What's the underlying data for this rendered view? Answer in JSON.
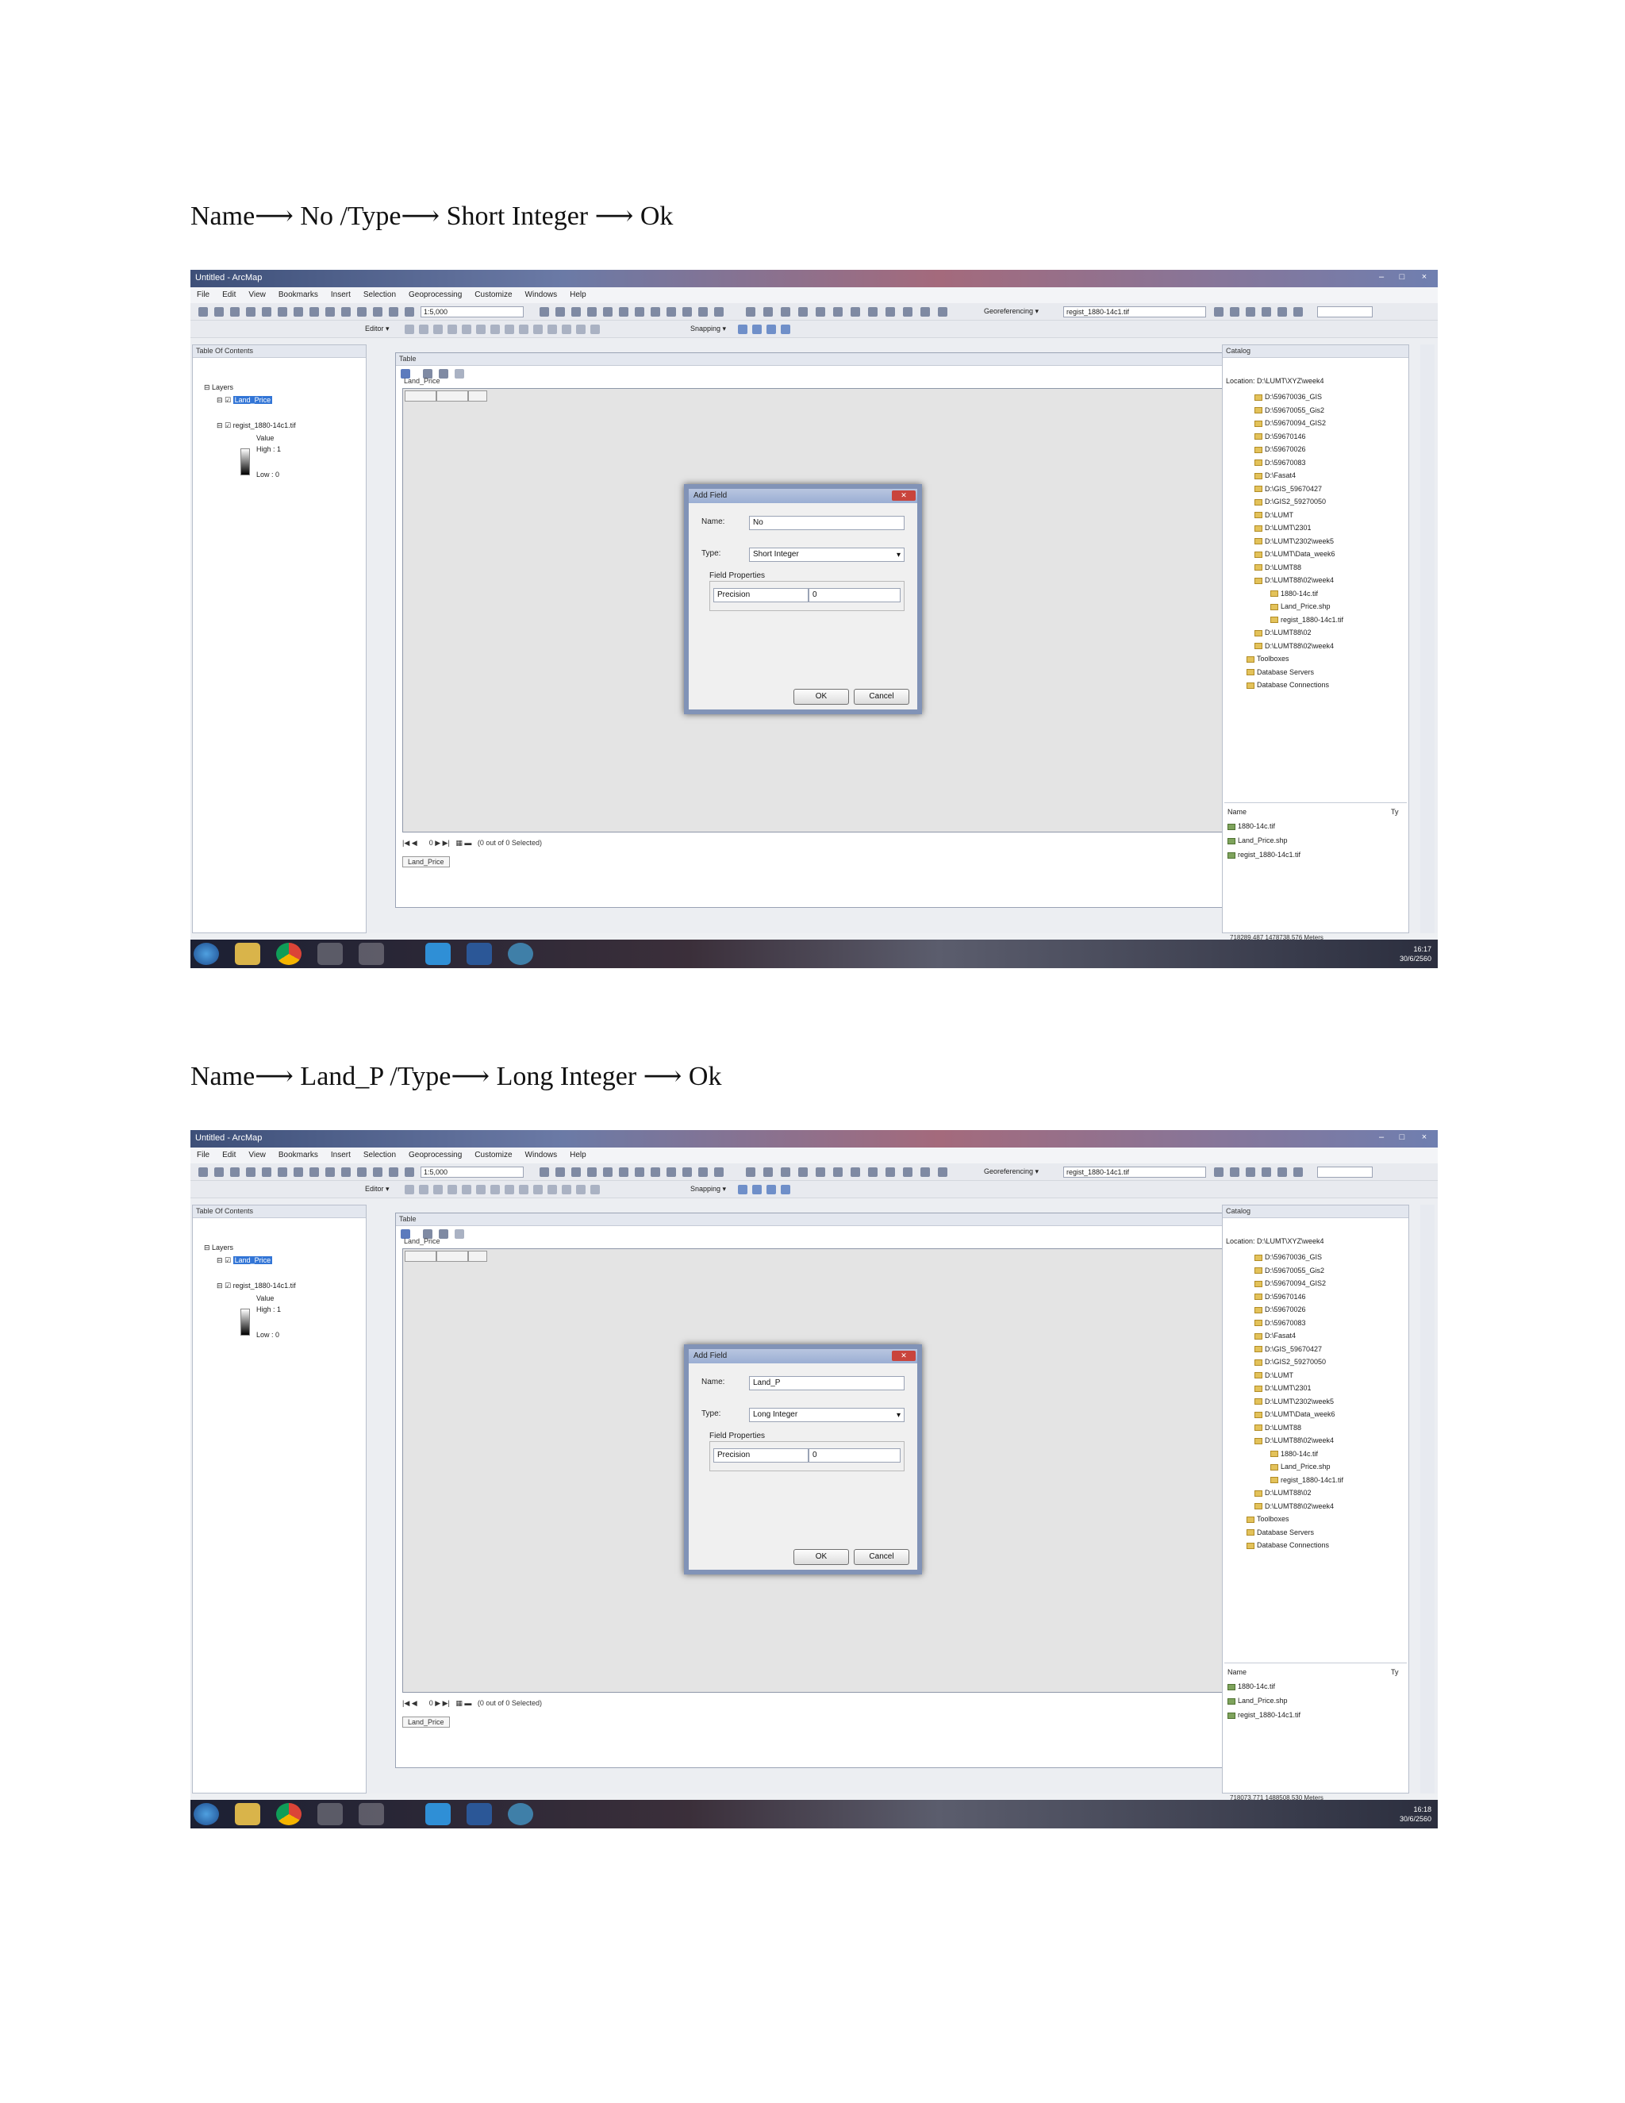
{
  "steps": [
    {
      "caption": "Name⟶ No /Type⟶ Short Integer ⟶ Ok",
      "screenshot": {
        "window_title": "Untitled - ArcMap",
        "menus": [
          "File",
          "Edit",
          "View",
          "Bookmarks",
          "Insert",
          "Selection",
          "Geoprocessing",
          "Customize",
          "Windows",
          "Help"
        ],
        "scale": "1:5,000",
        "georef_label": "Georeferencing ▾",
        "georef_layer": "regist_1880-14c1.tif",
        "editor_label": "Editor ▾",
        "snapping_label": "Snapping ▾",
        "toc": {
          "title": "Table Of Contents",
          "layers_label": "Layers",
          "layer1": "Land_Price",
          "layer2": "regist_1880-14c1.tif",
          "value_label": "Value",
          "high": "High : 1",
          "low": "Low : 0"
        },
        "table": {
          "title": "Table",
          "tab": "Land_Price",
          "nav": "0",
          "selected": "(0 out of 0 Selected)",
          "bottom_tab": "Land_Price"
        },
        "dialog": {
          "title": "Add Field",
          "name_label": "Name:",
          "name_value": "No",
          "type_label": "Type:",
          "type_value": "Short Integer",
          "props_label": "Field Properties",
          "precision_label": "Precision",
          "precision_value": "0",
          "ok": "OK",
          "cancel": "Cancel"
        },
        "catalog": {
          "title": "Catalog",
          "location_label": "Location:",
          "location": "D:\\LUMT\\XYZ\\week4",
          "items": [
            "D:\\59670036_GIS",
            "D:\\59670055_Gis2",
            "D:\\59670094_GIS2",
            "D:\\59670146",
            "D:\\59670026",
            "D:\\59670083",
            "D:\\Fasat4",
            "D:\\GIS_59670427",
            "D:\\GIS2_59270050",
            "D:\\LUMT",
            "D:\\LUMT\\2301",
            "D:\\LUMT\\2302\\week5",
            "D:\\LUMT\\Data_week6",
            "D:\\LUMT88",
            "D:\\LUMT88\\02\\week4",
            "1880-14c.tif",
            "Land_Price.shp",
            "regist_1880-14c1.tif",
            "D:\\LUMT88\\02",
            "D:\\LUMT88\\02\\week4",
            "Toolboxes",
            "Database Servers",
            "Database Connections"
          ],
          "list_header_name": "Name",
          "list_header_type": "Ty",
          "list_items": [
            "1880-14c.tif",
            "Land_Price.shp",
            "regist_1880-14c1.tif"
          ]
        },
        "status_coords": "718289.487 1478738.576 Meters",
        "clock_time": "16:17",
        "clock_date": "30/6/2560"
      }
    },
    {
      "caption": "Name⟶ Land_P /Type⟶ Long Integer ⟶ Ok",
      "screenshot": {
        "window_title": "Untitled - ArcMap",
        "menus": [
          "File",
          "Edit",
          "View",
          "Bookmarks",
          "Insert",
          "Selection",
          "Geoprocessing",
          "Customize",
          "Windows",
          "Help"
        ],
        "scale": "1:5,000",
        "georef_label": "Georeferencing ▾",
        "georef_layer": "regist_1880-14c1.tif",
        "editor_label": "Editor ▾",
        "snapping_label": "Snapping ▾",
        "toc": {
          "title": "Table Of Contents",
          "layers_label": "Layers",
          "layer1": "Land_Price",
          "layer2": "regist_1880-14c1.tif",
          "value_label": "Value",
          "high": "High : 1",
          "low": "Low : 0"
        },
        "table": {
          "title": "Table",
          "tab": "Land_Price",
          "nav": "0",
          "selected": "(0 out of 0 Selected)",
          "bottom_tab": "Land_Price"
        },
        "dialog": {
          "title": "Add Field",
          "name_label": "Name:",
          "name_value": "Land_P",
          "type_label": "Type:",
          "type_value": "Long Integer",
          "props_label": "Field Properties",
          "precision_label": "Precision",
          "precision_value": "0",
          "ok": "OK",
          "cancel": "Cancel"
        },
        "catalog": {
          "title": "Catalog",
          "location_label": "Location:",
          "location": "D:\\LUMT\\XYZ\\week4",
          "items": [
            "D:\\59670036_GIS",
            "D:\\59670055_Gis2",
            "D:\\59670094_GIS2",
            "D:\\59670146",
            "D:\\59670026",
            "D:\\59670083",
            "D:\\Fasat4",
            "D:\\GIS_59670427",
            "D:\\GIS2_59270050",
            "D:\\LUMT",
            "D:\\LUMT\\2301",
            "D:\\LUMT\\2302\\week5",
            "D:\\LUMT\\Data_week6",
            "D:\\LUMT88",
            "D:\\LUMT88\\02\\week4",
            "1880-14c.tif",
            "Land_Price.shp",
            "regist_1880-14c1.tif",
            "D:\\LUMT88\\02",
            "D:\\LUMT88\\02\\week4",
            "Toolboxes",
            "Database Servers",
            "Database Connections"
          ],
          "list_header_name": "Name",
          "list_header_type": "Ty",
          "list_items": [
            "1880-14c.tif",
            "Land_Price.shp",
            "regist_1880-14c1.tif"
          ]
        },
        "status_coords": "718073.771 1488508.530 Meters",
        "clock_time": "16:18",
        "clock_date": "30/6/2560"
      }
    }
  ]
}
